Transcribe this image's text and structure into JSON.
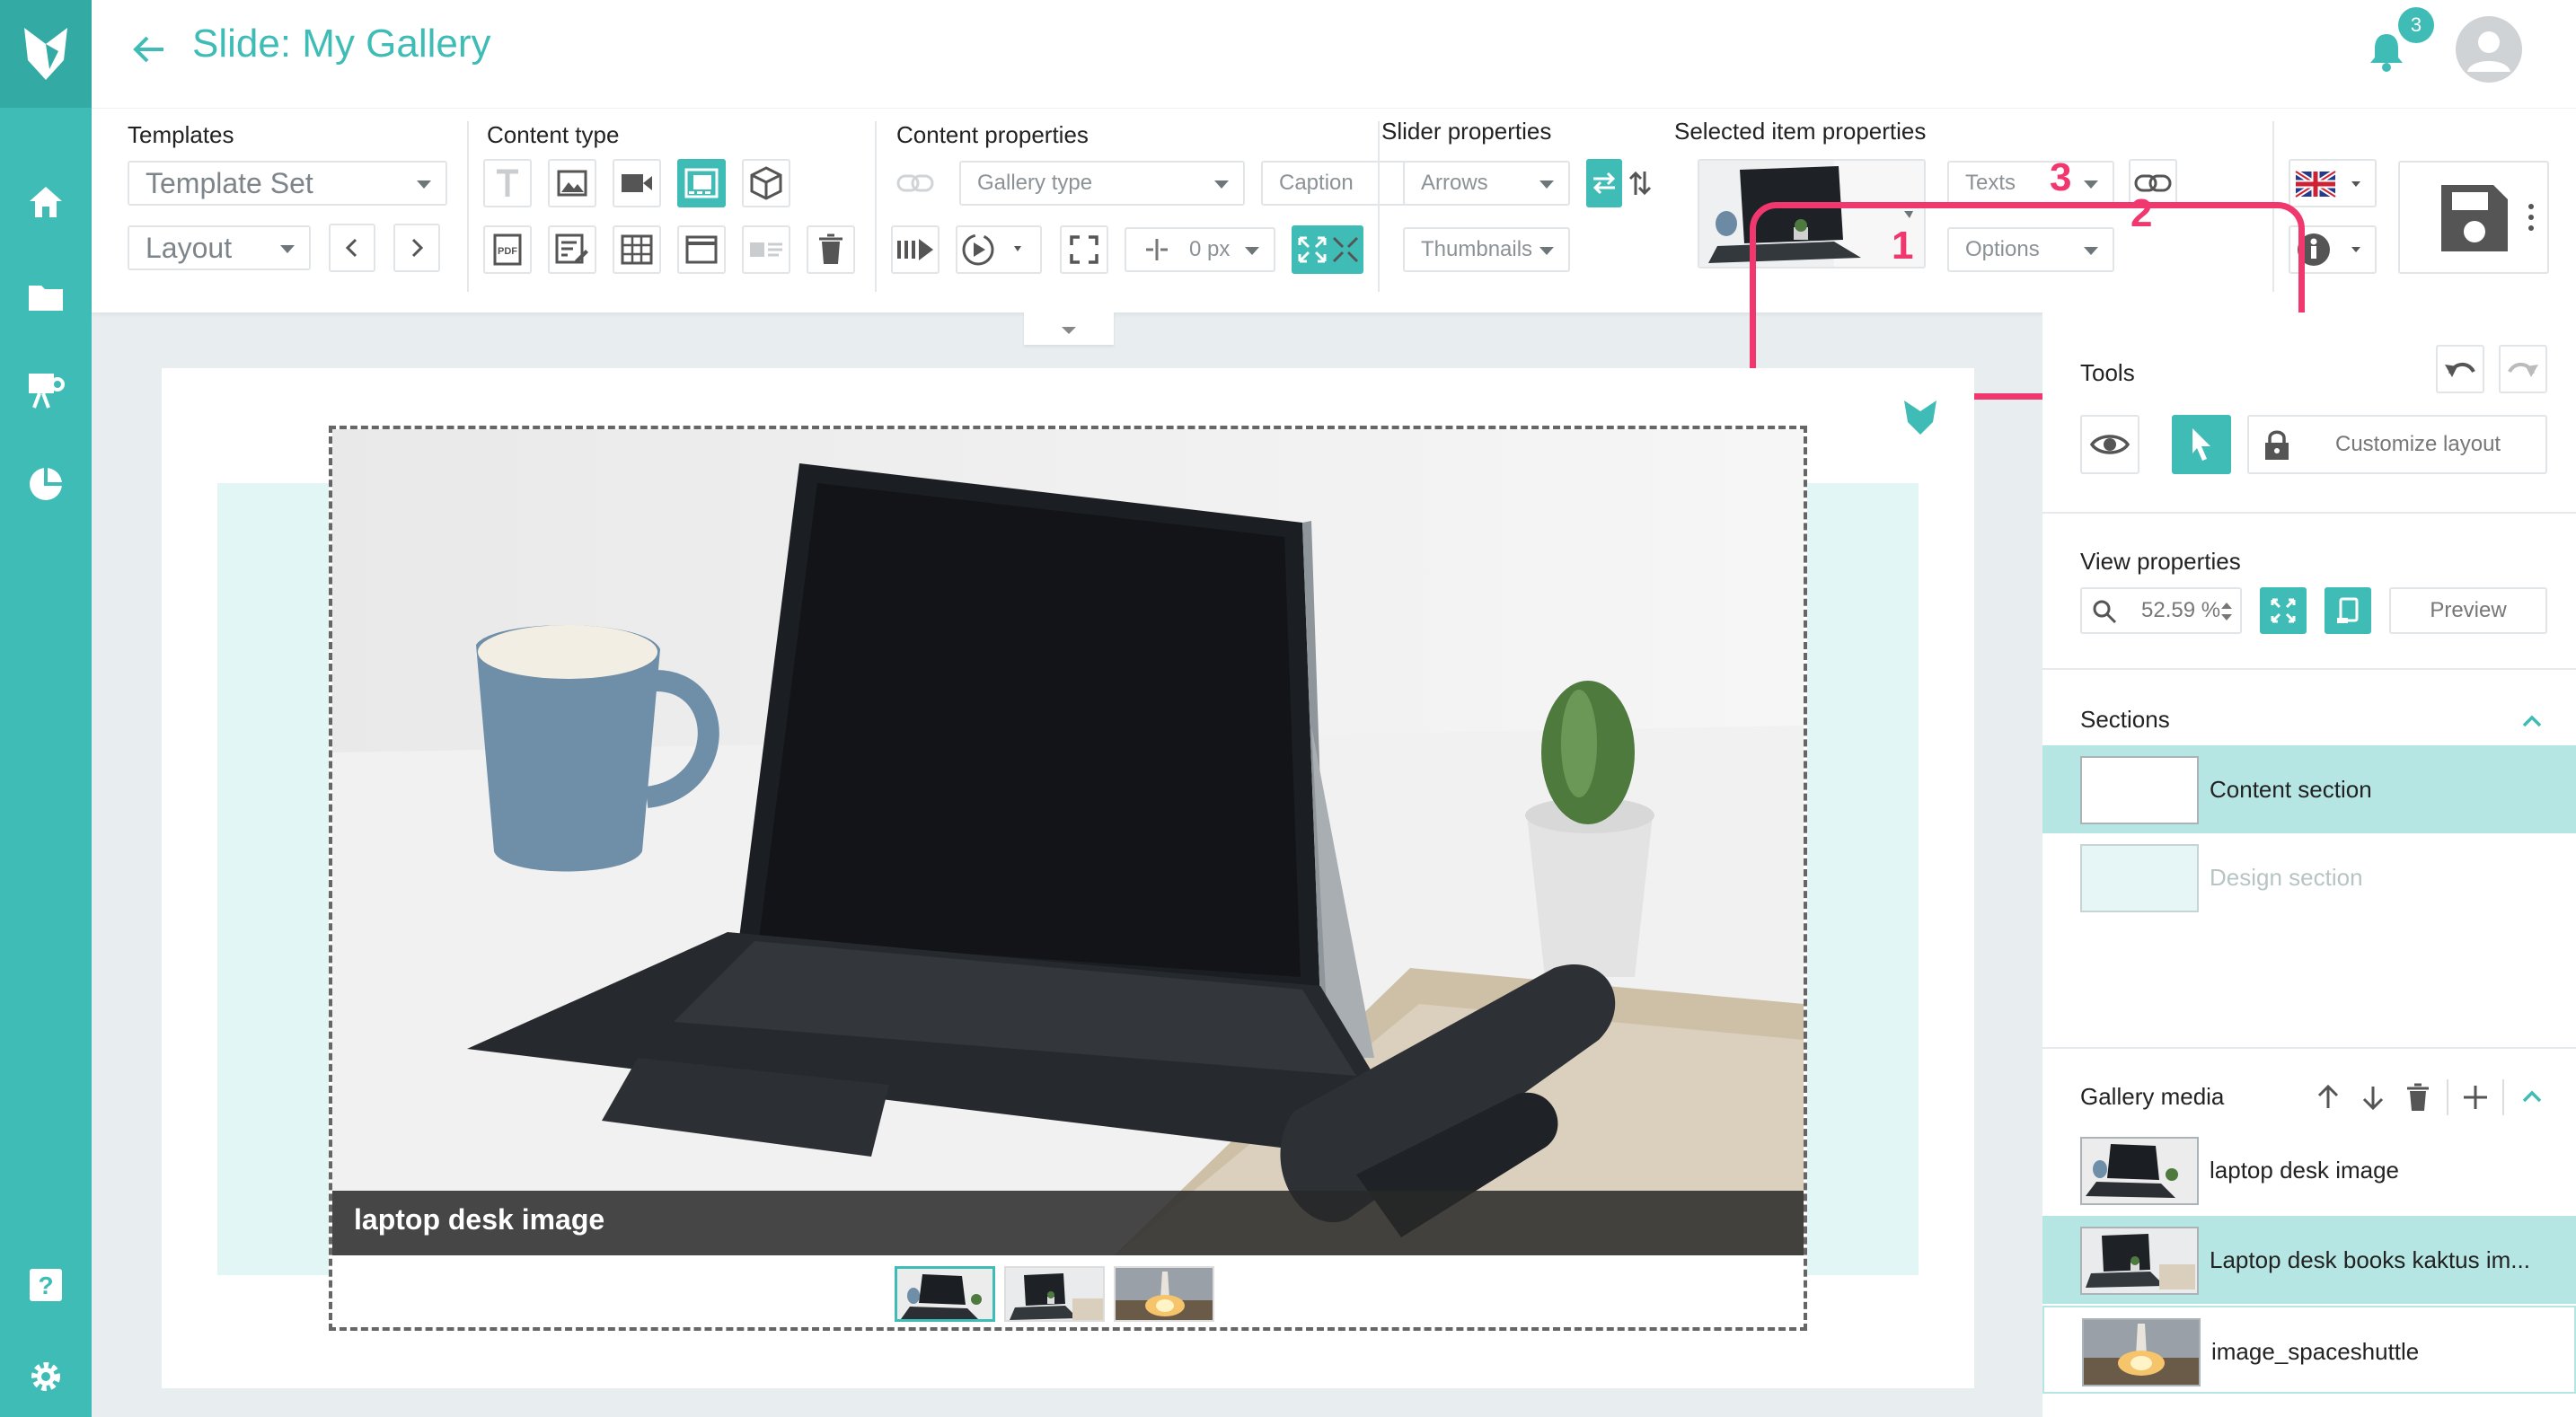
{
  "header": {
    "title": "Slide: My Gallery",
    "notification_count": "3"
  },
  "toolbar": {
    "templates": {
      "label": "Templates",
      "template_set": "Template Set",
      "layout": "Layout"
    },
    "content_type": {
      "label": "Content type"
    },
    "content_properties": {
      "label": "Content properties",
      "gallery_type": "Gallery type",
      "caption": "Caption",
      "spacing": "0 px"
    },
    "slider_properties": {
      "label": "Slider properties",
      "arrows": "Arrows",
      "thumbnails": "Thumbnails"
    },
    "selected_item": {
      "label": "Selected item properties",
      "texts": "Texts",
      "options": "Options"
    },
    "callouts": [
      "1",
      "2",
      "3"
    ]
  },
  "canvas": {
    "caption": "laptop desk image"
  },
  "panel": {
    "tools": {
      "label": "Tools",
      "customize_layout": "Customize layout"
    },
    "view": {
      "label": "View properties",
      "zoom": "52.59 %",
      "preview": "Preview"
    },
    "sections": {
      "label": "Sections",
      "items": [
        "Content section",
        "Design section"
      ]
    },
    "gallery_media": {
      "label": "Gallery media",
      "items": [
        "laptop desk image",
        "Laptop desk books kaktus im...",
        "image_spaceshuttle"
      ]
    }
  },
  "colors": {
    "accent": "#3fbcb6",
    "highlight": "#f0386e"
  }
}
